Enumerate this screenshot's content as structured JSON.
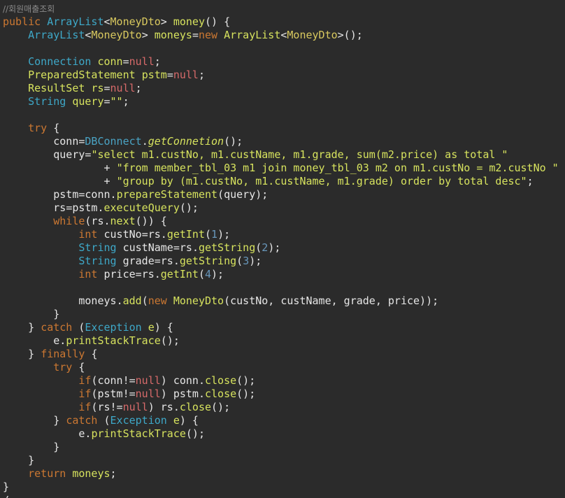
{
  "editor": {
    "background": "#2b2b2b",
    "lines": [
      [
        {
          "t": "//회원매출조회",
          "k": "comment"
        }
      ],
      [
        {
          "t": "public ",
          "k": "kw"
        },
        {
          "t": "ArrayList",
          "k": "type"
        },
        {
          "t": "<",
          "k": "plain"
        },
        {
          "t": "MoneyDto",
          "k": "generic"
        },
        {
          "t": "> ",
          "k": "plain"
        },
        {
          "t": "money",
          "k": "fn"
        },
        {
          "t": "() {",
          "k": "plain"
        }
      ],
      [
        {
          "t": "    ",
          "k": "plain"
        },
        {
          "t": "ArrayList",
          "k": "type"
        },
        {
          "t": "<",
          "k": "plain"
        },
        {
          "t": "MoneyDto",
          "k": "generic"
        },
        {
          "t": "> ",
          "k": "plain"
        },
        {
          "t": "moneys",
          "k": "method"
        },
        {
          "t": "=",
          "k": "plain"
        },
        {
          "t": "new ",
          "k": "kw"
        },
        {
          "t": "ArrayList",
          "k": "method"
        },
        {
          "t": "<",
          "k": "plain"
        },
        {
          "t": "MoneyDto",
          "k": "generic"
        },
        {
          "t": ">();",
          "k": "plain"
        }
      ],
      [],
      [
        {
          "t": "    ",
          "k": "plain"
        },
        {
          "t": "Connection ",
          "k": "type"
        },
        {
          "t": "conn",
          "k": "method"
        },
        {
          "t": "=",
          "k": "plain"
        },
        {
          "t": "null",
          "k": "null"
        },
        {
          "t": ";",
          "k": "plain"
        }
      ],
      [
        {
          "t": "    ",
          "k": "plain"
        },
        {
          "t": "PreparedStatement ",
          "k": "method"
        },
        {
          "t": "pstm",
          "k": "method"
        },
        {
          "t": "=",
          "k": "plain"
        },
        {
          "t": "null",
          "k": "null"
        },
        {
          "t": ";",
          "k": "plain"
        }
      ],
      [
        {
          "t": "    ",
          "k": "plain"
        },
        {
          "t": "ResultSet ",
          "k": "method"
        },
        {
          "t": "rs",
          "k": "method"
        },
        {
          "t": "=",
          "k": "plain"
        },
        {
          "t": "null",
          "k": "null"
        },
        {
          "t": ";",
          "k": "plain"
        }
      ],
      [
        {
          "t": "    ",
          "k": "plain"
        },
        {
          "t": "String ",
          "k": "type"
        },
        {
          "t": "query",
          "k": "method"
        },
        {
          "t": "=",
          "k": "plain"
        },
        {
          "t": "\"\"",
          "k": "string"
        },
        {
          "t": ";",
          "k": "plain"
        }
      ],
      [],
      [
        {
          "t": "    ",
          "k": "plain"
        },
        {
          "t": "try ",
          "k": "kw"
        },
        {
          "t": "{",
          "k": "plain"
        }
      ],
      [
        {
          "t": "        ",
          "k": "plain"
        },
        {
          "t": "conn",
          "k": "plain"
        },
        {
          "t": "=",
          "k": "plain"
        },
        {
          "t": "DBConnect",
          "k": "class"
        },
        {
          "t": ".",
          "k": "plain"
        },
        {
          "t": "getConnetion",
          "k": "italic"
        },
        {
          "t": "();",
          "k": "plain"
        }
      ],
      [
        {
          "t": "        ",
          "k": "plain"
        },
        {
          "t": "query",
          "k": "plain"
        },
        {
          "t": "=",
          "k": "plain"
        },
        {
          "t": "\"select m1.custNo, m1.custName, m1.grade, sum(m2.price) as total \"",
          "k": "string"
        }
      ],
      [
        {
          "t": "                + ",
          "k": "plain"
        },
        {
          "t": "\"from member_tbl_03 m1 join money_tbl_03 m2 on m1.custNo = m2.custNo \"",
          "k": "string"
        }
      ],
      [
        {
          "t": "                + ",
          "k": "plain"
        },
        {
          "t": "\"group by (m1.custNo, m1.custName, m1.grade) order by total desc\"",
          "k": "string"
        },
        {
          "t": ";",
          "k": "plain"
        }
      ],
      [
        {
          "t": "        ",
          "k": "plain"
        },
        {
          "t": "pstm",
          "k": "plain"
        },
        {
          "t": "=",
          "k": "plain"
        },
        {
          "t": "conn",
          "k": "plain"
        },
        {
          "t": ".",
          "k": "plain"
        },
        {
          "t": "prepareStatement",
          "k": "fn"
        },
        {
          "t": "(query);",
          "k": "plain"
        }
      ],
      [
        {
          "t": "        ",
          "k": "plain"
        },
        {
          "t": "rs",
          "k": "plain"
        },
        {
          "t": "=",
          "k": "plain"
        },
        {
          "t": "pstm",
          "k": "plain"
        },
        {
          "t": ".",
          "k": "plain"
        },
        {
          "t": "executeQuery",
          "k": "fn"
        },
        {
          "t": "();",
          "k": "plain"
        }
      ],
      [
        {
          "t": "        ",
          "k": "plain"
        },
        {
          "t": "while",
          "k": "kw"
        },
        {
          "t": "(rs.",
          "k": "plain"
        },
        {
          "t": "next",
          "k": "fn"
        },
        {
          "t": "()) {",
          "k": "plain"
        }
      ],
      [
        {
          "t": "            ",
          "k": "plain"
        },
        {
          "t": "int ",
          "k": "kw"
        },
        {
          "t": "custNo",
          "k": "plain"
        },
        {
          "t": "=",
          "k": "plain"
        },
        {
          "t": "rs",
          "k": "plain"
        },
        {
          "t": ".",
          "k": "plain"
        },
        {
          "t": "getInt",
          "k": "fn"
        },
        {
          "t": "(",
          "k": "plain"
        },
        {
          "t": "1",
          "k": "num"
        },
        {
          "t": ");",
          "k": "plain"
        }
      ],
      [
        {
          "t": "            ",
          "k": "plain"
        },
        {
          "t": "String ",
          "k": "type"
        },
        {
          "t": "custName",
          "k": "plain"
        },
        {
          "t": "=",
          "k": "plain"
        },
        {
          "t": "rs",
          "k": "plain"
        },
        {
          "t": ".",
          "k": "plain"
        },
        {
          "t": "getString",
          "k": "fn"
        },
        {
          "t": "(",
          "k": "plain"
        },
        {
          "t": "2",
          "k": "num"
        },
        {
          "t": ");",
          "k": "plain"
        }
      ],
      [
        {
          "t": "            ",
          "k": "plain"
        },
        {
          "t": "String ",
          "k": "type"
        },
        {
          "t": "grade",
          "k": "plain"
        },
        {
          "t": "=",
          "k": "plain"
        },
        {
          "t": "rs",
          "k": "plain"
        },
        {
          "t": ".",
          "k": "plain"
        },
        {
          "t": "getString",
          "k": "fn"
        },
        {
          "t": "(",
          "k": "plain"
        },
        {
          "t": "3",
          "k": "num"
        },
        {
          "t": ");",
          "k": "plain"
        }
      ],
      [
        {
          "t": "            ",
          "k": "plain"
        },
        {
          "t": "int ",
          "k": "kw"
        },
        {
          "t": "price",
          "k": "plain"
        },
        {
          "t": "=",
          "k": "plain"
        },
        {
          "t": "rs",
          "k": "plain"
        },
        {
          "t": ".",
          "k": "plain"
        },
        {
          "t": "getInt",
          "k": "fn"
        },
        {
          "t": "(",
          "k": "plain"
        },
        {
          "t": "4",
          "k": "num"
        },
        {
          "t": ");",
          "k": "plain"
        }
      ],
      [],
      [
        {
          "t": "            ",
          "k": "plain"
        },
        {
          "t": "moneys",
          "k": "plain"
        },
        {
          "t": ".",
          "k": "plain"
        },
        {
          "t": "add",
          "k": "fn"
        },
        {
          "t": "(",
          "k": "plain"
        },
        {
          "t": "new ",
          "k": "kw"
        },
        {
          "t": "MoneyDto",
          "k": "fn"
        },
        {
          "t": "(custNo, custName, grade, price));",
          "k": "plain"
        }
      ],
      [
        {
          "t": "        }",
          "k": "plain"
        }
      ],
      [
        {
          "t": "    } ",
          "k": "plain"
        },
        {
          "t": "catch ",
          "k": "kw"
        },
        {
          "t": "(",
          "k": "plain"
        },
        {
          "t": "Exception ",
          "k": "type"
        },
        {
          "t": "e",
          "k": "method"
        },
        {
          "t": ") {",
          "k": "plain"
        }
      ],
      [
        {
          "t": "        ",
          "k": "plain"
        },
        {
          "t": "e",
          "k": "plain"
        },
        {
          "t": ".",
          "k": "plain"
        },
        {
          "t": "printStackTrace",
          "k": "fn"
        },
        {
          "t": "();",
          "k": "plain"
        }
      ],
      [
        {
          "t": "    } ",
          "k": "plain"
        },
        {
          "t": "finally ",
          "k": "kw"
        },
        {
          "t": "{",
          "k": "plain"
        }
      ],
      [
        {
          "t": "        ",
          "k": "plain"
        },
        {
          "t": "try ",
          "k": "kw"
        },
        {
          "t": "{",
          "k": "plain"
        }
      ],
      [
        {
          "t": "            ",
          "k": "plain"
        },
        {
          "t": "if",
          "k": "kw"
        },
        {
          "t": "(conn!=",
          "k": "plain"
        },
        {
          "t": "null",
          "k": "null"
        },
        {
          "t": ") ",
          "k": "plain"
        },
        {
          "t": "conn",
          "k": "plain"
        },
        {
          "t": ".",
          "k": "plain"
        },
        {
          "t": "close",
          "k": "fn"
        },
        {
          "t": "();",
          "k": "plain"
        }
      ],
      [
        {
          "t": "            ",
          "k": "plain"
        },
        {
          "t": "if",
          "k": "kw"
        },
        {
          "t": "(pstm!=",
          "k": "plain"
        },
        {
          "t": "null",
          "k": "null"
        },
        {
          "t": ") ",
          "k": "plain"
        },
        {
          "t": "pstm",
          "k": "plain"
        },
        {
          "t": ".",
          "k": "plain"
        },
        {
          "t": "close",
          "k": "fn"
        },
        {
          "t": "();",
          "k": "plain"
        }
      ],
      [
        {
          "t": "            ",
          "k": "plain"
        },
        {
          "t": "if",
          "k": "kw"
        },
        {
          "t": "(rs!=",
          "k": "plain"
        },
        {
          "t": "null",
          "k": "null"
        },
        {
          "t": ") ",
          "k": "plain"
        },
        {
          "t": "rs",
          "k": "plain"
        },
        {
          "t": ".",
          "k": "plain"
        },
        {
          "t": "close",
          "k": "fn"
        },
        {
          "t": "();",
          "k": "plain"
        }
      ],
      [
        {
          "t": "        } ",
          "k": "plain"
        },
        {
          "t": "catch ",
          "k": "kw"
        },
        {
          "t": "(",
          "k": "plain"
        },
        {
          "t": "Exception ",
          "k": "type"
        },
        {
          "t": "e",
          "k": "method"
        },
        {
          "t": ") {",
          "k": "plain"
        }
      ],
      [
        {
          "t": "            ",
          "k": "plain"
        },
        {
          "t": "e",
          "k": "plain"
        },
        {
          "t": ".",
          "k": "plain"
        },
        {
          "t": "printStackTrace",
          "k": "fn"
        },
        {
          "t": "();",
          "k": "plain"
        }
      ],
      [
        {
          "t": "        }",
          "k": "plain"
        }
      ],
      [
        {
          "t": "    }",
          "k": "plain"
        }
      ],
      [
        {
          "t": "    ",
          "k": "plain"
        },
        {
          "t": "return ",
          "k": "kw"
        },
        {
          "t": "moneys",
          "k": "method"
        },
        {
          "t": ";",
          "k": "plain"
        }
      ],
      [
        {
          "t": "}",
          "k": "plain"
        }
      ],
      [
        {
          "t": "/",
          "k": "plain"
        }
      ]
    ]
  }
}
